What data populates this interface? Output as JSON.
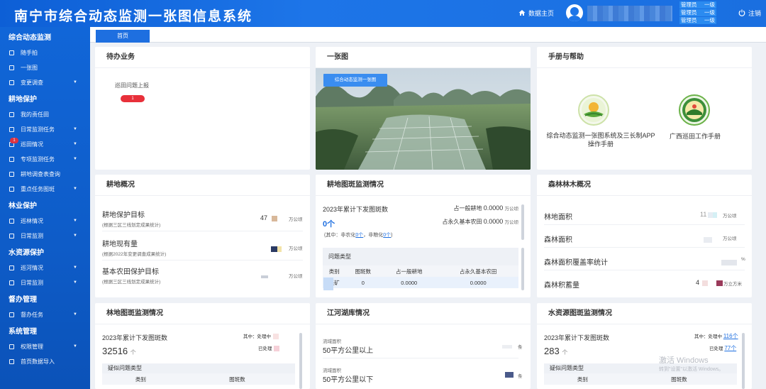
{
  "header": {
    "title": "南宁市综合动态监测一张图信息系统",
    "home": "数据主页",
    "roles": [
      {
        "name": "管理员",
        "level": "一级"
      },
      {
        "name": "管理员",
        "level": "一级"
      },
      {
        "name": "管理员",
        "level": "一级"
      }
    ],
    "logout": "注销"
  },
  "sidebar": {
    "sections": [
      {
        "title": "综合动态监测",
        "items": [
          {
            "label": "随手拍"
          },
          {
            "label": "一张图"
          },
          {
            "label": "变更调查",
            "arrow": true
          }
        ]
      },
      {
        "title": "耕地保护",
        "items": [
          {
            "label": "我的责任田"
          },
          {
            "label": "日常监测任务",
            "arrow": true
          },
          {
            "label": "巡田情况",
            "arrow": true,
            "badge": "1"
          },
          {
            "label": "专项监测任务",
            "arrow": true
          },
          {
            "label": "耕地调查表查询"
          },
          {
            "label": "重点任务图斑",
            "arrow": true
          }
        ]
      },
      {
        "title": "林业保护",
        "items": [
          {
            "label": "巡林情况",
            "arrow": true
          },
          {
            "label": "日常监测",
            "arrow": true
          }
        ]
      },
      {
        "title": "水资源保护",
        "items": [
          {
            "label": "巡河情况",
            "arrow": true
          },
          {
            "label": "日常监测",
            "arrow": true
          }
        ]
      },
      {
        "title": "督办管理",
        "items": [
          {
            "label": "督办任务",
            "arrow": true
          }
        ]
      },
      {
        "title": "系统管理",
        "items": [
          {
            "label": "权限管理",
            "arrow": true
          },
          {
            "label": "首页数据导入"
          }
        ]
      }
    ]
  },
  "tabs": [
    {
      "label": "首页"
    }
  ],
  "todo": {
    "title": "待办业务",
    "item": "巡田问题上报",
    "count": "1"
  },
  "map": {
    "title": "一张图",
    "button": "综合动态监测一张图"
  },
  "help": {
    "title": "手册与帮助",
    "items": [
      {
        "label": "综合动态监测一张图系统及三长制APP操作手册"
      },
      {
        "label": "广西巡田工作手册"
      }
    ]
  },
  "farmland": {
    "title": "耕地概况",
    "rows": [
      {
        "label": "耕地保护目标",
        "sub": "(根据三区三线划定成果统计)",
        "value": "47",
        "unit": "万公顷"
      },
      {
        "label": "耕地现有量",
        "sub": "(根据2022年变更调查成果统计)",
        "value": "",
        "unit": "万公顷"
      },
      {
        "label": "基本农田保护目标",
        "sub": "(根据三区三线划定成果统计)",
        "value": "",
        "unit": "万公顷"
      }
    ]
  },
  "farm_monitor": {
    "title": "耕地图斑监测情况",
    "year_label": "2023年累计下发图斑数",
    "count": "0个",
    "general_label": "占一般耕地",
    "general_value": "0.0000",
    "general_unit": "万公顷",
    "basic_label": "占永久基本农田",
    "basic_value": "0.0000",
    "basic_unit": "万公顷",
    "sub_prefix": "(其中：非农化",
    "sub_nonag": "0个",
    "sub_mid": "，非粮化",
    "sub_nongrain": "0个",
    "sub_suffix": ")",
    "problem_type": "问题类型",
    "columns": [
      "类别",
      "图斑数",
      "占一般耕地",
      "占永久基本农田"
    ],
    "rows": [
      [
        "采矿",
        "0",
        "0.0000",
        "0.0000"
      ]
    ]
  },
  "forest": {
    "title": "森林林木概况",
    "rows": [
      {
        "label": "林地面积",
        "value": "11",
        "unit": "万公顷"
      },
      {
        "label": "森林面积",
        "value": "",
        "unit": "万公顷"
      },
      {
        "label": "森林面积覆盖率统计",
        "value": "",
        "unit": "%"
      },
      {
        "label": "森林积蓄量",
        "value": "4",
        "unit": "万立方米"
      }
    ]
  },
  "forest_monitor": {
    "title": "林地图斑监测情况",
    "year_label": "2023年累计下发图斑数",
    "count": "32516",
    "count_unit": "个",
    "processing_label": "其中：处理中",
    "processed_label": "已处理",
    "problem_type": "疑似问题类型",
    "columns": [
      "类别",
      "图斑数"
    ]
  },
  "lakes": {
    "title": "江河湖库情况",
    "rows": [
      {
        "sub": "流域面积",
        "label": "50平方公里以上",
        "value": "",
        "unit": "条"
      },
      {
        "sub": "流域面积",
        "label": "50平方公里以下",
        "value": "",
        "unit": "条"
      }
    ]
  },
  "water_monitor": {
    "title": "水资源图斑监测情况",
    "year_label": "2023年累计下发图斑数",
    "count": "283",
    "count_unit": "个",
    "processing_label": "其中：处理中",
    "processing_value": "116个",
    "processed_label": "已处理",
    "processed_value": "77个",
    "problem_type": "疑似问题类型",
    "columns": [
      "类别",
      "图斑数"
    ]
  },
  "watermark": {
    "line1": "激活 Windows",
    "line2": "转到\"设置\"以激活 Windows。"
  },
  "colors": {
    "primary": "#1d75e8",
    "sidebar": "#1166d8",
    "badge": "#e8303a",
    "link": "#1e6fe0"
  }
}
